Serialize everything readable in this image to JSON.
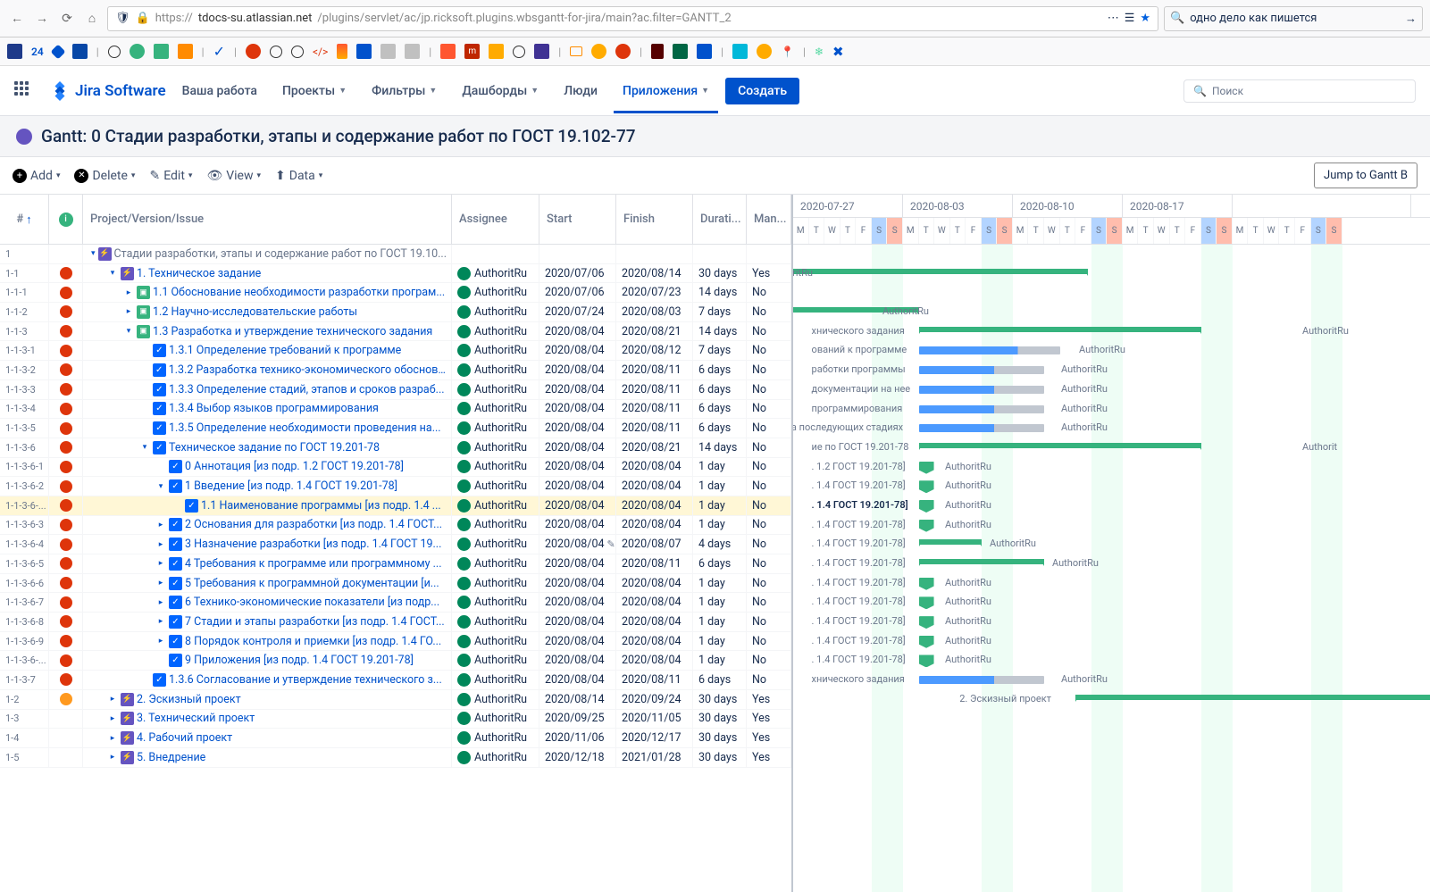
{
  "browser": {
    "url_prefix": "https://",
    "url_domain": "tdocs-su.atlassian.net",
    "url_path": "/plugins/servlet/ac/jp.ricksoft.plugins.wbsgantt-for-jira/main?ac.filter=GANTT_2",
    "search": "одно дело как пишется",
    "bookmark_num": "24"
  },
  "jira": {
    "logo": "Jira Software",
    "nav": [
      "Ваша работа",
      "Проекты",
      "Фильтры",
      "Дашборды",
      "Люди",
      "Приложения"
    ],
    "create": "Создать",
    "search_ph": "Поиск"
  },
  "page": {
    "title": "Gantt: 0 Стадии разработки, этапы и содержание работ по ГОСТ 19.102-77"
  },
  "toolbar": {
    "add": "Add",
    "delete": "Delete",
    "edit": "Edit",
    "view": "View",
    "data": "Data",
    "jump": "Jump to Gantt B"
  },
  "headers": {
    "num": "#",
    "project": "Project/Version/Issue",
    "assignee": "Assignee",
    "start": "Start",
    "finish": "Finish",
    "duration": "Durati...",
    "manual": "Man..."
  },
  "weeks": [
    "2020-07-27",
    "2020-08-03",
    "2020-08-10",
    "2020-08-17"
  ],
  "days": [
    "M",
    "T",
    "W",
    "T",
    "F",
    "S",
    "S"
  ],
  "assignee": "AuthoritRu",
  "rows": [
    {
      "id": "1",
      "prio": "",
      "indent": 0,
      "tw": "v",
      "type": "epic",
      "title": "Стадии разработки, этапы и содержание работ по ГОСТ 19.10...",
      "root": true
    },
    {
      "id": "1-1",
      "prio": "h",
      "indent": 1,
      "tw": "v",
      "type": "epic",
      "title": "1. Техническое задание",
      "a": 1,
      "start": "2020/07/06",
      "finish": "2020/08/14",
      "dur": "30 days",
      "man": "Yes"
    },
    {
      "id": "1-1-1",
      "prio": "h",
      "indent": 2,
      "tw": ">",
      "type": "story",
      "title": "1.1 Обоснование необходимости разработки програм...",
      "a": 1,
      "start": "2020/07/06",
      "finish": "2020/07/23",
      "dur": "14 days",
      "man": "No"
    },
    {
      "id": "1-1-2",
      "prio": "h",
      "indent": 2,
      "tw": ">",
      "type": "story",
      "title": "1.2 Научно-исследовательские работы",
      "a": 1,
      "start": "2020/07/24",
      "finish": "2020/08/03",
      "dur": "7 days",
      "man": "No"
    },
    {
      "id": "1-1-3",
      "prio": "h",
      "indent": 2,
      "tw": "v",
      "type": "story",
      "title": "1.3 Разработка и утверждение технического задания",
      "a": 1,
      "start": "2020/08/04",
      "finish": "2020/08/21",
      "dur": "14 days",
      "man": "No"
    },
    {
      "id": "1-1-3-1",
      "prio": "h",
      "indent": 3,
      "tw": "",
      "type": "task",
      "title": "1.3.1 Определение требований к программе",
      "a": 1,
      "start": "2020/08/04",
      "finish": "2020/08/12",
      "dur": "7 days",
      "man": "No"
    },
    {
      "id": "1-1-3-2",
      "prio": "h",
      "indent": 3,
      "tw": "",
      "type": "task",
      "title": "1.3.2 Разработка технико-экономического обоснов...",
      "a": 1,
      "start": "2020/08/04",
      "finish": "2020/08/11",
      "dur": "6 days",
      "man": "No"
    },
    {
      "id": "1-1-3-3",
      "prio": "h",
      "indent": 3,
      "tw": "",
      "type": "task",
      "title": "1.3.3 Определение стадий, этапов и сроков разраб...",
      "a": 1,
      "start": "2020/08/04",
      "finish": "2020/08/11",
      "dur": "6 days",
      "man": "No"
    },
    {
      "id": "1-1-3-4",
      "prio": "h",
      "indent": 3,
      "tw": "",
      "type": "task",
      "title": "1.3.4 Выбор языков программирования",
      "a": 1,
      "start": "2020/08/04",
      "finish": "2020/08/11",
      "dur": "6 days",
      "man": "No"
    },
    {
      "id": "1-1-3-5",
      "prio": "h",
      "indent": 3,
      "tw": "",
      "type": "task",
      "title": "1.3.5 Определение необходимости проведения на...",
      "a": 1,
      "start": "2020/08/04",
      "finish": "2020/08/11",
      "dur": "6 days",
      "man": "No"
    },
    {
      "id": "1-1-3-6",
      "prio": "h",
      "indent": 3,
      "tw": "v",
      "type": "task",
      "title": "Техническое задание по ГОСТ 19.201-78",
      "a": 1,
      "start": "2020/08/04",
      "finish": "2020/08/21",
      "dur": "14 days",
      "man": "No"
    },
    {
      "id": "1-1-3-6-1",
      "prio": "h",
      "indent": 4,
      "tw": "",
      "type": "task",
      "title": "0 Аннотация [из подр. 1.2 ГОСТ 19.201-78]",
      "a": 1,
      "start": "2020/08/04",
      "finish": "2020/08/04",
      "dur": "1 day",
      "man": "No"
    },
    {
      "id": "1-1-3-6-2",
      "prio": "h",
      "indent": 4,
      "tw": "v",
      "type": "task",
      "title": "1 Введение [из подр. 1.4 ГОСТ 19.201-78]",
      "a": 1,
      "start": "2020/08/04",
      "finish": "2020/08/04",
      "dur": "1 day",
      "man": "No"
    },
    {
      "id": "1-1-3-6-...",
      "prio": "h",
      "indent": 5,
      "tw": "",
      "type": "task",
      "title": "1.1 Наименование программы [из подр. 1.4 ...",
      "a": 1,
      "start": "2020/08/04",
      "finish": "2020/08/04",
      "dur": "1 day",
      "man": "No",
      "sel": true
    },
    {
      "id": "1-1-3-6-3",
      "prio": "h",
      "indent": 4,
      "tw": ">",
      "type": "task",
      "title": "2 Основания для разработки [из подр. 1.4 ГОСТ...",
      "a": 1,
      "start": "2020/08/04",
      "finish": "2020/08/04",
      "dur": "1 day",
      "man": "No"
    },
    {
      "id": "1-1-3-6-4",
      "prio": "h",
      "indent": 4,
      "tw": ">",
      "type": "task",
      "title": "3 Назначение разработки [из подр. 1.4 ГОСТ 19...",
      "a": 1,
      "start": "2020/08/04",
      "finish": "2020/08/07",
      "dur": "4 days",
      "man": "No",
      "edit": true
    },
    {
      "id": "1-1-3-6-5",
      "prio": "h",
      "indent": 4,
      "tw": ">",
      "type": "task",
      "title": "4 Требования к программе или программному ...",
      "a": 1,
      "start": "2020/08/04",
      "finish": "2020/08/11",
      "dur": "6 days",
      "man": "No"
    },
    {
      "id": "1-1-3-6-6",
      "prio": "h",
      "indent": 4,
      "tw": ">",
      "type": "task",
      "title": "5 Требования к программной документации [и...",
      "a": 1,
      "start": "2020/08/04",
      "finish": "2020/08/04",
      "dur": "1 day",
      "man": "No"
    },
    {
      "id": "1-1-3-6-7",
      "prio": "h",
      "indent": 4,
      "tw": ">",
      "type": "task",
      "title": "6 Технико-экономические показатели [из подр...",
      "a": 1,
      "start": "2020/08/04",
      "finish": "2020/08/04",
      "dur": "1 day",
      "man": "No"
    },
    {
      "id": "1-1-3-6-8",
      "prio": "h",
      "indent": 4,
      "tw": ">",
      "type": "task",
      "title": "7 Стадии и этапы разработки [из подр. 1.4 ГОСТ...",
      "a": 1,
      "start": "2020/08/04",
      "finish": "2020/08/04",
      "dur": "1 day",
      "man": "No"
    },
    {
      "id": "1-1-3-6-9",
      "prio": "h",
      "indent": 4,
      "tw": ">",
      "type": "task",
      "title": "8 Порядок контроля и приемки [из подр. 1.4 ГО...",
      "a": 1,
      "start": "2020/08/04",
      "finish": "2020/08/04",
      "dur": "1 day",
      "man": "No"
    },
    {
      "id": "1-1-3-6-...",
      "prio": "h",
      "indent": 4,
      "tw": "",
      "type": "task",
      "title": "9 Приложения [из подр. 1.4 ГОСТ 19.201-78]",
      "a": 1,
      "start": "2020/08/04",
      "finish": "2020/08/04",
      "dur": "1 day",
      "man": "No"
    },
    {
      "id": "1-1-3-7",
      "prio": "h",
      "indent": 3,
      "tw": "",
      "type": "task",
      "title": "1.3.6 Согласование и утверждение технического з...",
      "a": 1,
      "start": "2020/08/04",
      "finish": "2020/08/11",
      "dur": "6 days",
      "man": "No"
    },
    {
      "id": "1-2",
      "prio": "m",
      "indent": 1,
      "tw": ">",
      "type": "epic",
      "title": "2. Эскизный проект",
      "a": 1,
      "start": "2020/08/14",
      "finish": "2020/09/24",
      "dur": "30 days",
      "man": "Yes"
    },
    {
      "id": "1-3",
      "prio": "",
      "indent": 1,
      "tw": ">",
      "type": "epic",
      "title": "3. Технический проект",
      "a": 1,
      "start": "2020/09/25",
      "finish": "2020/11/05",
      "dur": "30 days",
      "man": "Yes"
    },
    {
      "id": "1-4",
      "prio": "",
      "indent": 1,
      "tw": ">",
      "type": "epic",
      "title": "4. Рабочий проект",
      "a": 1,
      "start": "2020/11/06",
      "finish": "2020/12/17",
      "dur": "30 days",
      "man": "Yes"
    },
    {
      "id": "1-5",
      "prio": "",
      "indent": 1,
      "tw": ">",
      "type": "epic",
      "title": "5. Внедрение",
      "a": 1,
      "start": "2020/12/18",
      "finish": "2021/01/28",
      "dur": "30 days",
      "man": "Yes"
    }
  ],
  "gantt_labels": {
    "r1": "AuthoritRu",
    "r2": "Ru",
    "r3": "AuthoritRu",
    "r4": "хнического задания",
    "r4b": "AuthoritRu",
    "r5": "ований к программе",
    "r5b": "AuthoritRu",
    "r6": "работки программы",
    "r6b": "AuthoritRu",
    "r7": "документации на нее",
    "r7b": "AuthoritRu",
    "r8": "программирования",
    "r8b": "AuthoritRu",
    "r9": "льских работ на последующих стадиях",
    "r9b": "AuthoritRu",
    "r10": "ие по ГОСТ 19.201-78",
    "r10b": "Authorit",
    "r11": ". 1.2 ГОСТ 19.201-78]",
    "r11b": "AuthoritRu",
    "r12": ". 1.4 ГОСТ 19.201-78]",
    "r12b": "AuthoritRu",
    "r13": ". 1.4 ГОСТ 19.201-78]",
    "r13b": "AuthoritRu",
    "r14": ". 1.4 ГОСТ 19.201-78]",
    "r14b": "AuthoritRu",
    "r15": ". 1.4 ГОСТ 19.201-78]",
    "r15b": "AuthoritRu",
    "r16": ". 1.4 ГОСТ 19.201-78]",
    "r16b": "AuthoritRu",
    "r17": ". 1.4 ГОСТ 19.201-78]",
    "r17b": "AuthoritRu",
    "r18": ". 1.4 ГОСТ 19.201-78]",
    "r18b": "AuthoritRu",
    "r19": ". 1.4 ГОСТ 19.201-78]",
    "r19b": "AuthoritRu",
    "r20": ". 1.4 ГОСТ 19.201-78]",
    "r20b": "AuthoritRu",
    "r21": ". 1.4 ГОСТ 19.201-78]",
    "r21b": "AuthoritRu",
    "r22": "хнического задания",
    "r22b": "AuthoritRu",
    "r23": "2. Эскизный проект"
  }
}
